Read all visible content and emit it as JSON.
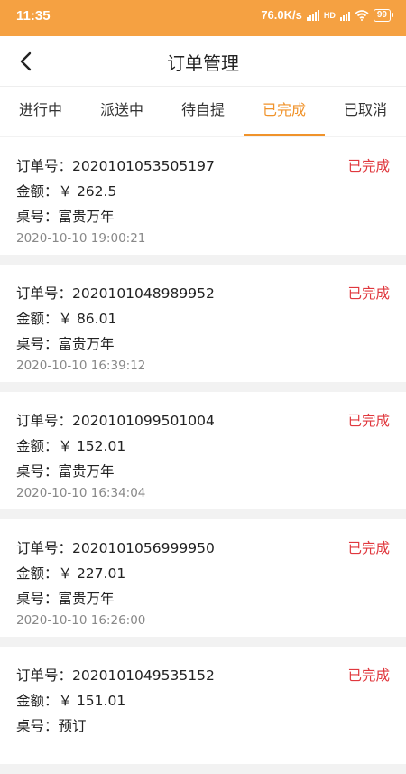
{
  "status_bar": {
    "time": "11:35",
    "speed": "76.0K/s",
    "battery": "99"
  },
  "header": {
    "title": "订单管理"
  },
  "tabs": [
    {
      "label": "进行中",
      "active": false
    },
    {
      "label": "派送中",
      "active": false
    },
    {
      "label": "待自提",
      "active": false
    },
    {
      "label": "已完成",
      "active": true
    },
    {
      "label": "已取消",
      "active": false
    }
  ],
  "labels": {
    "order_no": "订单号：",
    "amount": "金额：",
    "table": "桌号："
  },
  "orders": [
    {
      "order_no": "2020101053505197",
      "amount": "￥ 262.5",
      "table": "富贵万年",
      "time": "2020-10-10 19:00:21",
      "status": "已完成"
    },
    {
      "order_no": "2020101048989952",
      "amount": "￥ 86.01",
      "table": "富贵万年",
      "time": "2020-10-10 16:39:12",
      "status": "已完成"
    },
    {
      "order_no": "2020101099501004",
      "amount": "￥ 152.01",
      "table": "富贵万年",
      "time": "2020-10-10 16:34:04",
      "status": "已完成"
    },
    {
      "order_no": "2020101056999950",
      "amount": "￥ 227.01",
      "table": "富贵万年",
      "time": "2020-10-10 16:26:00",
      "status": "已完成"
    },
    {
      "order_no": "2020101049535152",
      "amount": "￥ 151.01",
      "table": "预订",
      "time": "",
      "status": "已完成"
    }
  ],
  "colors": {
    "accent": "#f0932b",
    "status_bar": "#f5a142",
    "status_done": "#e0383e"
  }
}
